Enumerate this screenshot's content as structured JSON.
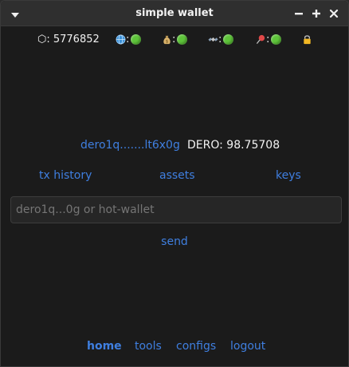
{
  "window": {
    "title": "simple wallet"
  },
  "status": {
    "height_label": "⬡: 5776852",
    "network_sep": ":",
    "wallet_sep": ":",
    "daemon_sep": ":",
    "sync_sep": ":",
    "indicator_color": "#5ec43a",
    "icons": [
      "globe-icon",
      "money-bag-icon",
      "satellite-icon",
      "push-pin-icon",
      "lock-icon"
    ]
  },
  "account": {
    "address_short": "dero1q.......lt6x0g",
    "balance": "DERO: 98.75708"
  },
  "tabs": {
    "tx_history": "tx history",
    "assets": "assets",
    "keys": "keys"
  },
  "transfer": {
    "placeholder": "dero1q...0g or hot-wallet",
    "send_label": "send"
  },
  "footer": {
    "home": "home",
    "tools": "tools",
    "configs": "configs",
    "logout": "logout"
  },
  "colors": {
    "accent": "#3f7fe0",
    "background": "#1b1b1b"
  }
}
